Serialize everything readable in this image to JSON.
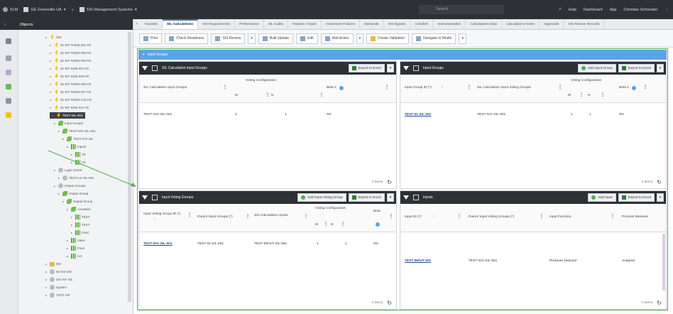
{
  "topbar": {
    "items": [
      "SLM",
      "GE Greenville UA",
      "SIS Management Systems"
    ],
    "search": "Search",
    "right_items": [
      "Help",
      "Dashboard",
      "App",
      "Christian Schneider"
    ]
  },
  "left_nav": {
    "title": "Objects",
    "tree": [
      {
        "label": "Site",
        "level": 0,
        "icon": "bolt-icon"
      },
      {
        "label": "52 SIF F5209 001 FD",
        "level": 1,
        "icon": "bolt-icon"
      },
      {
        "label": "52 SIF F5209 002 FD",
        "level": 1,
        "icon": "bolt-icon"
      },
      {
        "label": "52 SIF F5209 003 FD",
        "level": 1,
        "icon": "bolt-icon"
      },
      {
        "label": "52 SIF 5209 004 FD",
        "level": 1,
        "icon": "bolt-icon"
      },
      {
        "label": "52 SIF 5209 005 FD",
        "level": 1,
        "icon": "bolt-icon"
      },
      {
        "label": "52 SIF F5209 006 FD",
        "level": 1,
        "icon": "bolt-icon"
      },
      {
        "label": "52 SIF F5209 007 FD",
        "level": 1,
        "icon": "bolt-icon"
      },
      {
        "label": "52 SIF F5209 C10 FD",
        "level": 1,
        "icon": "bolt-icon"
      },
      {
        "label": "52 SIF 5209 011 FD",
        "level": 1,
        "icon": "bolt-icon"
      },
      {
        "label": "TEST-SIL-001",
        "level": 1,
        "icon": "bolt-icon",
        "selected": true
      },
      {
        "label": "Input Groups",
        "level": 2,
        "icon": "leaf-icon"
      },
      {
        "label": "TEST-IVG-SIL-001",
        "level": 3,
        "icon": "leaf-icon"
      },
      {
        "label": "TEST-IVG-SIL",
        "level": 4,
        "icon": "leaf-icon"
      },
      {
        "label": "Inputs",
        "level": 5,
        "icon": "grid-icon"
      },
      {
        "label": "TE",
        "level": 6,
        "icon": "grid-icon"
      },
      {
        "label": "TE",
        "level": 6,
        "icon": "grid-icon"
      },
      {
        "label": "Logic Solver",
        "level": 2,
        "icon": "gray-icon"
      },
      {
        "label": "TEST-LS-SIL-001",
        "level": 3,
        "icon": "gray-icon"
      },
      {
        "label": "Output Groups",
        "level": 2,
        "icon": "gray-icon"
      },
      {
        "label": "Output Group",
        "level": 3,
        "icon": "leaf-icon"
      },
      {
        "label": "Output Group",
        "level": 4,
        "icon": "leaf-icon"
      },
      {
        "label": "Actuation",
        "level": 5,
        "icon": "leaf-icon"
      },
      {
        "label": "TEST",
        "level": 6,
        "icon": "grid-icon"
      },
      {
        "label": "TEST",
        "level": 6,
        "icon": "grid-icon"
      },
      {
        "label": "Final",
        "level": 6,
        "icon": "grid-icon"
      },
      {
        "label": "Valve",
        "level": 5,
        "icon": "grid-icon"
      },
      {
        "label": "Final",
        "level": 5,
        "icon": "grid-icon"
      },
      {
        "label": "Act",
        "level": 5,
        "icon": "grid-icon"
      },
      {
        "label": "SIS",
        "level": 0,
        "icon": "folder-icon"
      },
      {
        "label": "52 SIS SIS",
        "level": 0,
        "icon": "gray-icon"
      },
      {
        "label": "SIS SIF SIL",
        "level": 0,
        "icon": "gray-icon"
      },
      {
        "label": "System",
        "level": 0,
        "icon": "gray-icon"
      },
      {
        "label": "TEST SIF",
        "level": 0,
        "icon": "gray-icon"
      }
    ]
  },
  "tabs": {
    "items": [
      "Hazards",
      "SIL Calculations",
      "SIS Requirements",
      "Performance",
      "SIL Audits",
      "Failures / Inputs",
      "Instrument Failures",
      "Demands",
      "SIS Bypass",
      "Activities",
      "Instrumentation",
      "Calculations Data",
      "Calculations Notes",
      "Approvals",
      "SIS Review Records"
    ],
    "active": 1
  },
  "toolbar": {
    "buttons": [
      "Print",
      "Check Readiness",
      "SIS Review",
      "Bulk Update",
      "Edit",
      "Add Action",
      "Create Validation",
      "Navigate to Model"
    ]
  },
  "section": {
    "title": "Input Groups"
  },
  "panels": {
    "ivg": {
      "title": "SIL Calculation Input Groups",
      "actions": [
        "Export to Excel"
      ],
      "headers": [
        "SIL Calculation Input Groups",
        "Voting Configuration",
        "M",
        "N",
        "Beta 1"
      ],
      "rows": [
        [
          "TEST-IVG-SIL-001",
          "1",
          "1",
          "0%"
        ]
      ],
      "footer": "0 items"
    },
    "input_groups": {
      "title": "Input Groups",
      "actions": [
        "Add Input Group",
        "Export to Excel"
      ],
      "headers": [
        "Input Group ID (*)",
        "SIL Calculation Input Voting Groups",
        "Voting Configuration",
        "M",
        "N",
        "Beta 1"
      ],
      "rows": [
        [
          "TEST-IG-SIL-001",
          "TEST-IVG-SIL-001",
          "1",
          "1",
          "0%"
        ]
      ],
      "footer": "0 items"
    },
    "voting_groups": {
      "title": "Input Voting Groups",
      "actions": [
        "Add Input Voting Group",
        "Export to Excel"
      ],
      "headers": [
        "Input Voting Group ID (*)",
        "Parent Input Groups (*)",
        "SIS Calculation Inputs",
        "Voting Configuration",
        "M",
        "N",
        "Beta"
      ],
      "rows": [
        [
          "TEST-IVG-SIL-001",
          "TEST-IG-SIL-001",
          "TEST-INPUT-SIL-001",
          "1",
          "1",
          "0%"
        ]
      ],
      "footer": "0 items"
    },
    "inputs": {
      "title": "Inputs",
      "actions": [
        "Add Input",
        "Export to Excel"
      ],
      "headers": [
        "Input ID (*)",
        "Parent Input Voting Groups (*)",
        "Input Function",
        "Process Measure"
      ],
      "rows": [
        [
          "TEST-INPUT-001",
          "TEST-IVG-SIL-001",
          "Pressure Detector",
          "Analyzer"
        ]
      ],
      "footer": "0 items"
    }
  },
  "colors": {
    "dark": "#2d3035",
    "accent_blue": "#5aa3e6",
    "annotation_green": "#4caf50",
    "link": "#1f4e9a"
  }
}
